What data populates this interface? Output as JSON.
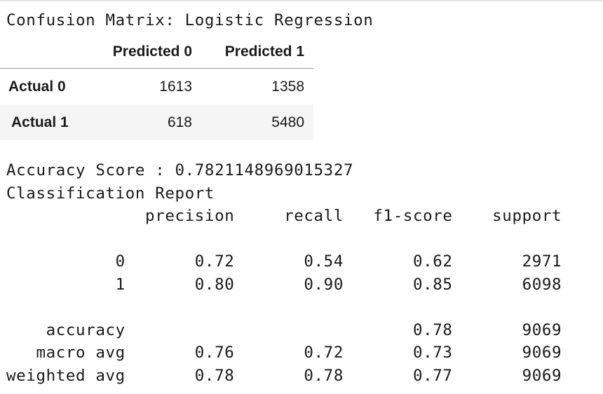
{
  "title": "Confusion Matrix: Logistic Regression",
  "confusion_matrix": {
    "columns": [
      "Predicted 0",
      "Predicted 1"
    ],
    "rows": [
      {
        "label": "Actual 0",
        "values": [
          "1613",
          "1358"
        ]
      },
      {
        "label": "Actual 1",
        "values": [
          "618",
          "5480"
        ]
      }
    ]
  },
  "accuracy_line": "Accuracy Score : 0.7821148969015327",
  "report_title": "Classification Report",
  "report": {
    "header": [
      "precision",
      "recall",
      "f1-score",
      "support"
    ],
    "rows": [
      {
        "label": "0",
        "precision": "0.72",
        "recall": "0.54",
        "f1": "0.62",
        "support": "2971"
      },
      {
        "label": "1",
        "precision": "0.80",
        "recall": "0.90",
        "f1": "0.85",
        "support": "6098"
      },
      {
        "label": "accuracy",
        "precision": "",
        "recall": "",
        "f1": "0.78",
        "support": "9069"
      },
      {
        "label": "macro avg",
        "precision": "0.76",
        "recall": "0.72",
        "f1": "0.73",
        "support": "9069"
      },
      {
        "label": "weighted avg",
        "precision": "0.78",
        "recall": "0.78",
        "f1": "0.77",
        "support": "9069"
      }
    ]
  }
}
